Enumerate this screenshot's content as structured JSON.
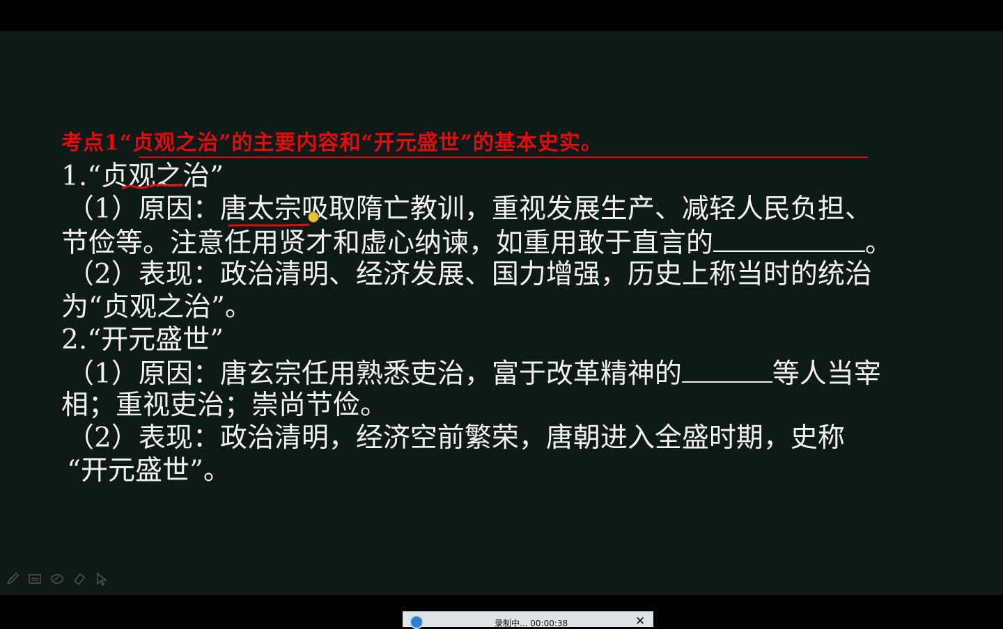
{
  "slide": {
    "heading": "考点1“贞观之治”的主要内容和“开元盛世”的基本史实。",
    "lines": [
      "1.“贞观之治”",
      "（1）原因：唐太宗吸取隋亡教训，重视发展生产、减轻人民负担、",
      "节俭等。注意任用贤才和虚心纳谏，如重用敢于直言的",
      "。",
      "（2）表现：政治清明、经济发展、国力增强，历史上称当时的统治",
      "为“贞观之治”。",
      "2.“开元盛世”",
      "（1）原因：唐玄宗任用熟悉吏治，富于改革精神的",
      "等人当宰",
      "相；重视吏治；崇尚节俭。",
      "（2）表现：政治清明，经济空前繁荣，唐朝进入全盛时期，史称",
      "“开元盛世”。"
    ]
  },
  "colors": {
    "slide_bg": "#0e1a17",
    "text": "#f2f2f2",
    "heading": "#e30c0c",
    "annotation": "#e30c0c"
  },
  "toolbar": {
    "tools": [
      "pen-icon",
      "screen-icon",
      "eraser-oval-icon",
      "eraser-icon",
      "pointer-icon"
    ]
  },
  "recorder": {
    "status": "录制中... 00:00:38",
    "close": "✕"
  }
}
